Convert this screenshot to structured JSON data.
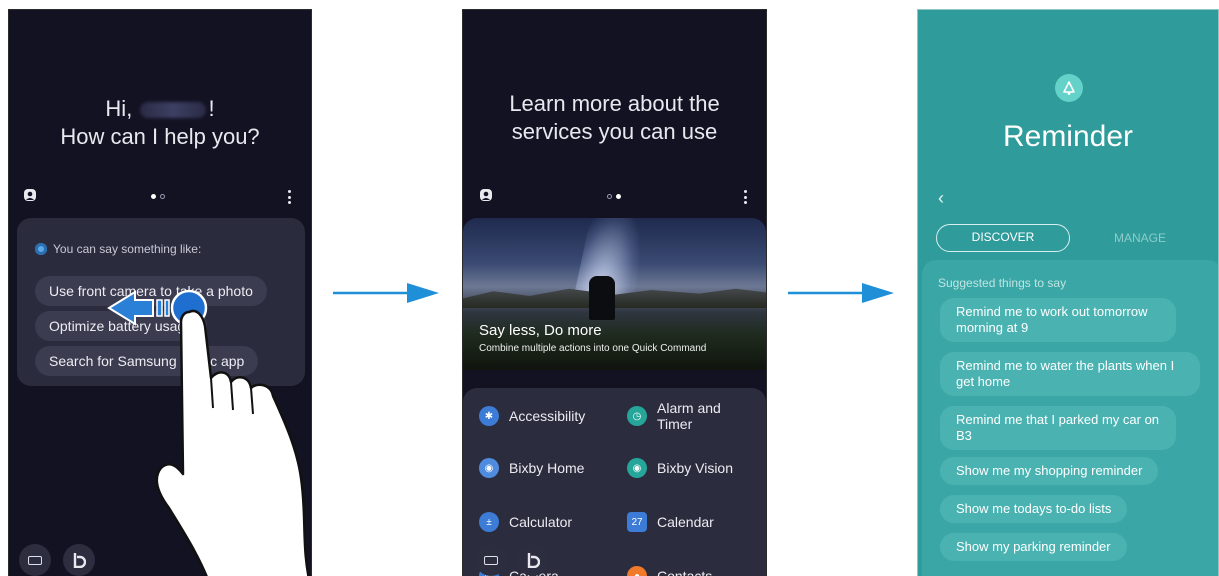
{
  "phone1": {
    "greeting_line1_prefix": "Hi,",
    "greeting_line1_suffix": "!",
    "greeting_line2": "How can I help you?",
    "suggest_header": "You can say something like:",
    "suggestions": [
      "Use front camera to take a photo",
      "Optimize battery usage",
      "Search for Samsung Music app"
    ],
    "page_indicator": {
      "count": 2,
      "active": 1
    }
  },
  "phone2": {
    "heading_line1": "Learn more about the",
    "heading_line2": "services you can use",
    "hero_title": "Say less, Do more",
    "hero_subtitle": "Combine multiple actions into one Quick Command",
    "apps": [
      {
        "label": "Accessibility",
        "icon": "accessibility-icon",
        "color": "#3c7cd6"
      },
      {
        "label": "Alarm and Timer",
        "icon": "clock-icon",
        "color": "#26a69a"
      },
      {
        "label": "Bixby Home",
        "icon": "bixby-home-icon",
        "color": "#4f8ce0"
      },
      {
        "label": "Bixby Vision",
        "icon": "eye-icon",
        "color": "#26a69a"
      },
      {
        "label": "Calculator",
        "icon": "calculator-icon",
        "color": "#3c7cd6"
      },
      {
        "label": "Calendar",
        "icon": "calendar-icon",
        "color": "#3c7cd6"
      },
      {
        "label": "Camera",
        "icon": "camera-icon",
        "color": "#3c7cd6"
      },
      {
        "label": "Contacts",
        "icon": "contacts-icon",
        "color": "#f07a2a"
      }
    ],
    "page_indicator": {
      "count": 2,
      "active": 2
    }
  },
  "phone3": {
    "title": "Reminder",
    "tab_discover": "DISCOVER",
    "tab_manage": "MANAGE",
    "suggest_header": "Suggested things to say",
    "suggestions": [
      "Remind me to work out tomorrow morning at 9",
      "Remind me to water the plants when I get home",
      "Remind me that I parked my car on B3",
      "Show me my shopping reminder",
      "Show me todays to-do lists",
      "Show my parking reminder"
    ]
  },
  "colors": {
    "dark_bg": "#131223",
    "card": "#2a2b3d",
    "teal": "#2f9c9b",
    "arrow": "#1f8fd8"
  }
}
